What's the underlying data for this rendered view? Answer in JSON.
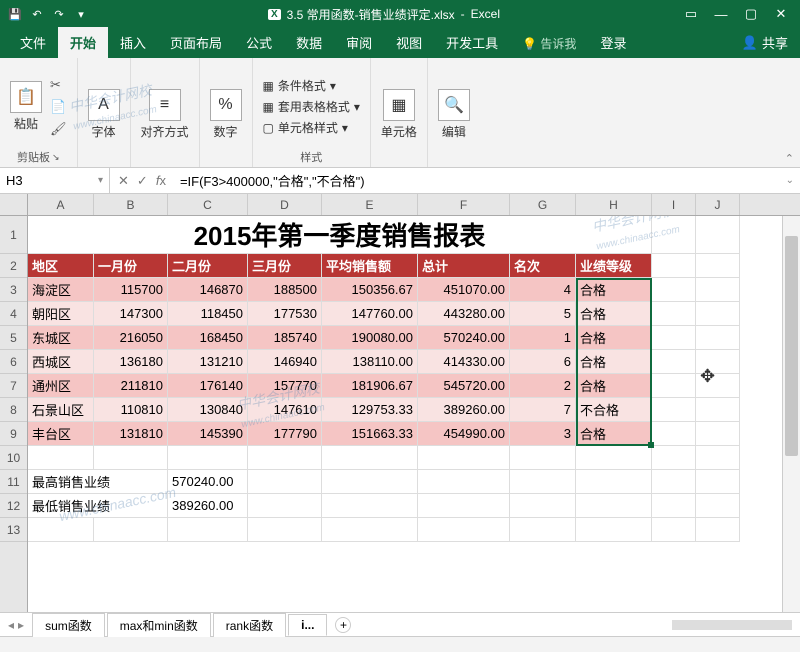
{
  "titlebar": {
    "app": "Excel",
    "filename": "3.5 常用函数-销售业绩评定.xlsx"
  },
  "tabs": {
    "file": "文件",
    "home": "开始",
    "insert": "插入",
    "layout": "页面布局",
    "formulas": "公式",
    "data": "数据",
    "review": "审阅",
    "view": "视图",
    "dev": "开发工具",
    "tell": "告诉我",
    "signin": "登录",
    "share": "共享"
  },
  "ribbon": {
    "paste": "粘贴",
    "clipboard": "剪贴板",
    "font": "字体",
    "align": "对齐方式",
    "number": "数字",
    "conditional": "条件格式",
    "tablefmt": "套用表格格式",
    "cellstyle": "单元格样式",
    "styles": "样式",
    "cells": "单元格",
    "editing": "编辑"
  },
  "namebox": "H3",
  "formula": "=IF(F3>400000,\"合格\",\"不合格\")",
  "columns": [
    "A",
    "B",
    "C",
    "D",
    "E",
    "F",
    "G",
    "H",
    "I",
    "J"
  ],
  "rownums": [
    "1",
    "2",
    "3",
    "4",
    "5",
    "6",
    "7",
    "8",
    "9",
    "10",
    "11",
    "12",
    "13"
  ],
  "title": "2015年第一季度销售报表",
  "headers": {
    "area": "地区",
    "m1": "一月份",
    "m2": "二月份",
    "m3": "三月份",
    "avg": "平均销售额",
    "total": "总计",
    "rank": "名次",
    "grade": "业绩等级"
  },
  "rows": [
    {
      "area": "海淀区",
      "m1": "115700",
      "m2": "146870",
      "m3": "188500",
      "avg": "150356.67",
      "total": "451070.00",
      "rank": "4",
      "grade": "合格"
    },
    {
      "area": "朝阳区",
      "m1": "147300",
      "m2": "118450",
      "m3": "177530",
      "avg": "147760.00",
      "total": "443280.00",
      "rank": "5",
      "grade": "合格"
    },
    {
      "area": "东城区",
      "m1": "216050",
      "m2": "168450",
      "m3": "185740",
      "avg": "190080.00",
      "total": "570240.00",
      "rank": "1",
      "grade": "合格"
    },
    {
      "area": "西城区",
      "m1": "136180",
      "m2": "131210",
      "m3": "146940",
      "avg": "138110.00",
      "total": "414330.00",
      "rank": "6",
      "grade": "合格"
    },
    {
      "area": "通州区",
      "m1": "211810",
      "m2": "176140",
      "m3": "157770",
      "avg": "181906.67",
      "total": "545720.00",
      "rank": "2",
      "grade": "合格"
    },
    {
      "area": "石景山区",
      "m1": "110810",
      "m2": "130840",
      "m3": "147610",
      "avg": "129753.33",
      "total": "389260.00",
      "rank": "7",
      "grade": "不合格"
    },
    {
      "area": "丰台区",
      "m1": "131810",
      "m2": "145390",
      "m3": "177790",
      "avg": "151663.33",
      "total": "454990.00",
      "rank": "3",
      "grade": "合格"
    }
  ],
  "stats": {
    "max_label": "最高销售业绩",
    "max_val": "570240.00",
    "min_label": "最低销售业绩",
    "min_val": "389260.00"
  },
  "sheets": {
    "s1": "sum函数",
    "s2": "max和min函数",
    "s3": "rank函数",
    "s4": "i..."
  }
}
